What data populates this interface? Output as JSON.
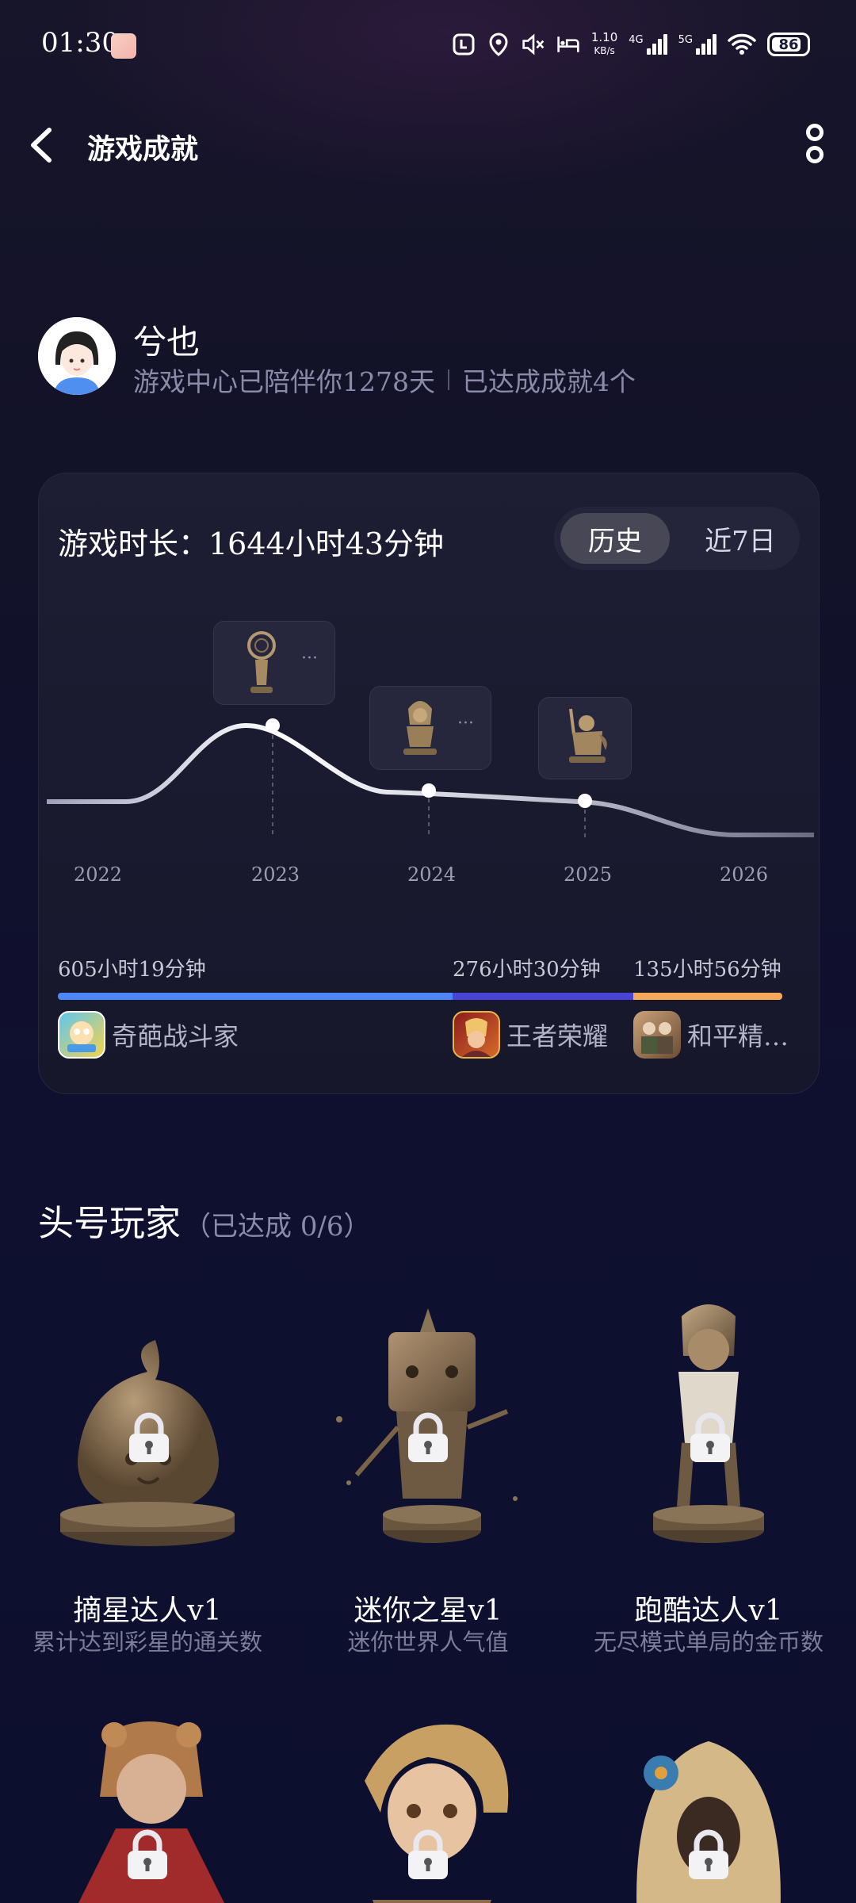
{
  "status_bar": {
    "time": "01:30",
    "speed_value": "1.10",
    "speed_unit": "KB/s",
    "net1": "4G",
    "net2": "5G",
    "battery": "86"
  },
  "header": {
    "title": "游戏成就"
  },
  "profile": {
    "name": "兮也",
    "days_text": "游戏中心已陪伴你1278天",
    "achievements_text": "已达成成就4个"
  },
  "playtime": {
    "label": "游戏时长：1644小时43分钟",
    "tabs": [
      "历史",
      "近7日"
    ],
    "active_tab": "历史"
  },
  "chart_data": {
    "type": "line",
    "x": [
      "2022",
      "2023",
      "2024",
      "2025",
      "2026"
    ],
    "markers": [
      {
        "year": "2023",
        "more": "···"
      },
      {
        "year": "2024",
        "more": "···"
      },
      {
        "year": "2025"
      }
    ]
  },
  "top_games": [
    {
      "duration": "605小时19分钟",
      "name": "奇葩战斗家",
      "color": "#4f86f7",
      "share": 0.532
    },
    {
      "duration": "276小时30分钟",
      "name": "王者荣耀",
      "color": "#4a44d6",
      "share": 0.243
    },
    {
      "duration": "135小时56分钟",
      "name": "和平精…",
      "color": "#f6a85a",
      "share": 0.225
    }
  ],
  "section": {
    "title": "头号玩家",
    "subtitle": "（已达成 0/6）"
  },
  "achievements": [
    {
      "name": "摘星达人v1",
      "desc": "累计达到彩星的通关数"
    },
    {
      "name": "迷你之星v1",
      "desc": "迷你世界人气值"
    },
    {
      "name": "跑酷达人v1",
      "desc": "无尽模式单局的金币数"
    }
  ]
}
